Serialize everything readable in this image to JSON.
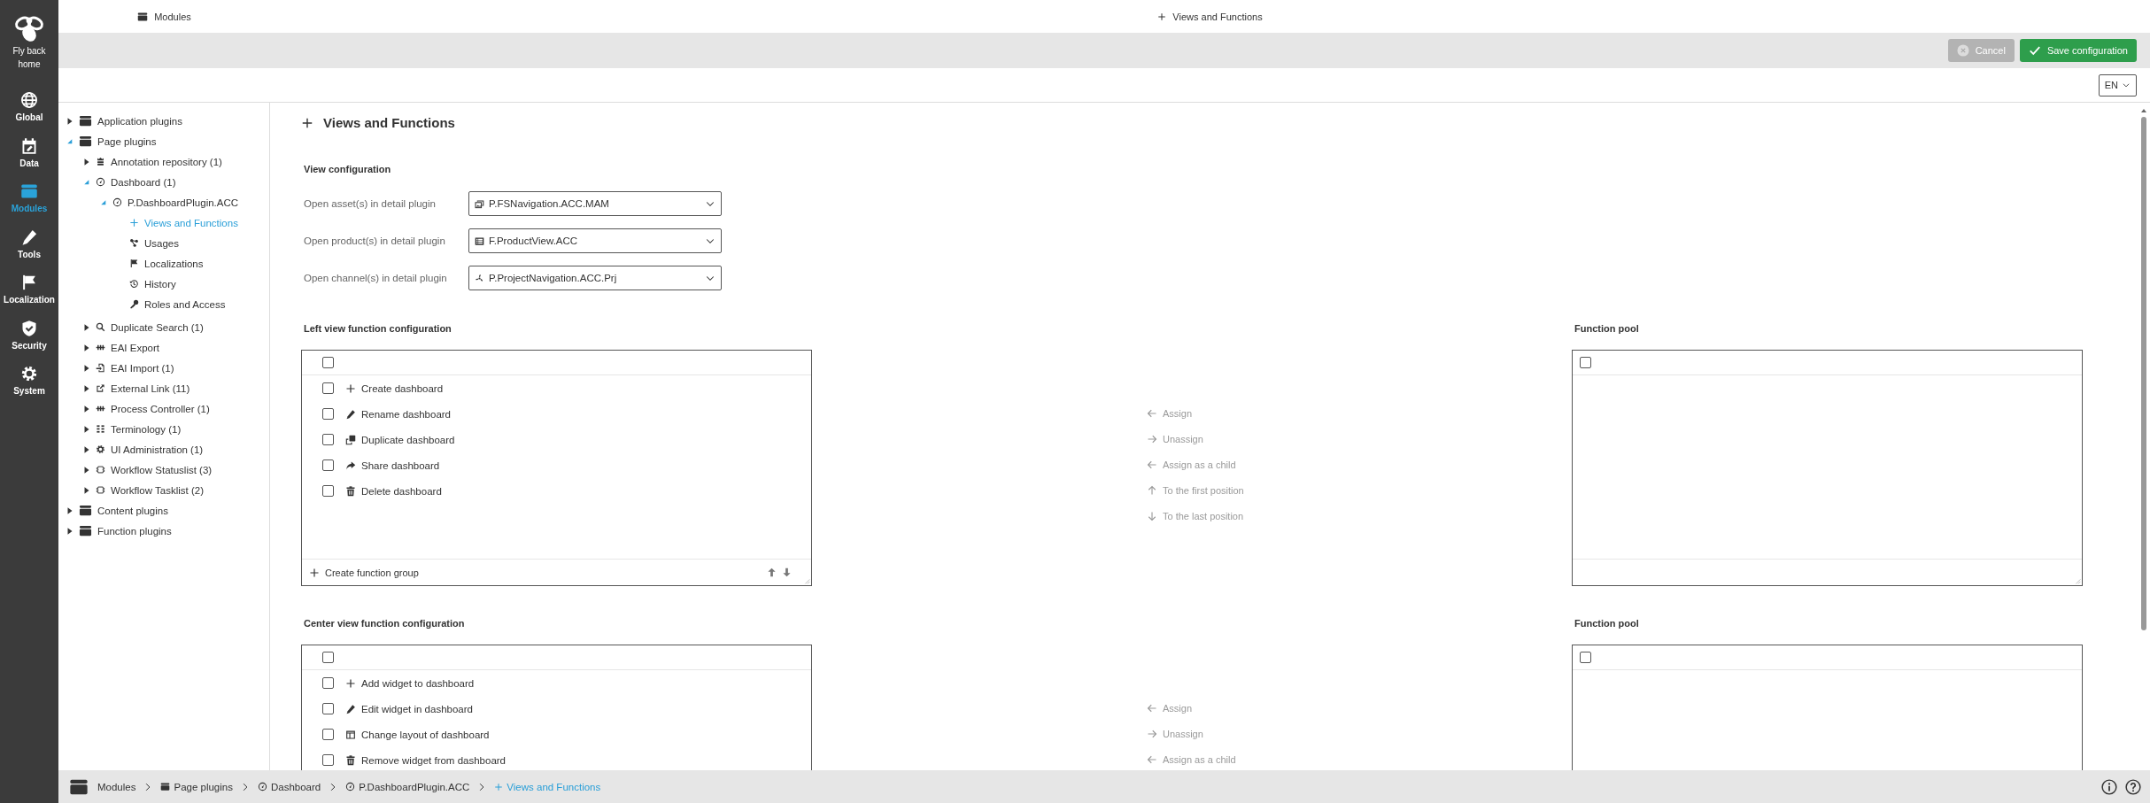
{
  "rail": {
    "logo_label": "Fly back home",
    "items": [
      {
        "label": "Global",
        "kind": "globe",
        "selected": false
      },
      {
        "label": "Data",
        "kind": "calendar",
        "selected": false
      },
      {
        "label": "Modules",
        "kind": "module",
        "selected": true
      },
      {
        "label": "Tools",
        "kind": "pencil",
        "selected": false
      },
      {
        "label": "Localization",
        "kind": "flag",
        "selected": false
      },
      {
        "label": "Security",
        "kind": "shield",
        "selected": false
      },
      {
        "label": "System",
        "kind": "gear",
        "selected": false
      }
    ]
  },
  "header": {
    "left_title": {
      "label": "Modules",
      "kind": "module"
    },
    "right_title": {
      "label": "Views and Functions",
      "kind": "plus"
    }
  },
  "toolbar": {
    "buttons": [
      {
        "label": "Cancel",
        "kind": "cancel",
        "disabled": true
      },
      {
        "label": "Save configuration",
        "kind": "save",
        "disabled": false
      }
    ],
    "language": "EN"
  },
  "tree": [
    {
      "label": "Application plugins",
      "kind": "module",
      "expanded": false,
      "selected": false
    },
    {
      "label": "Page plugins",
      "kind": "module",
      "expanded": true,
      "selected": false,
      "children": [
        {
          "label": "Annotation repository (1)",
          "kind": "annotation",
          "expanded": false,
          "selected": false
        },
        {
          "label": "Dashboard (1)",
          "kind": "gauge",
          "expanded": true,
          "selected": false,
          "children": [
            {
              "label": "P.DashboardPlugin.ACC",
              "kind": "gauge",
              "expanded": true,
              "selected": false,
              "children": [
                {
                  "label": "Views and Functions",
                  "kind": "plus",
                  "selected": true
                },
                {
                  "label": "Usages",
                  "kind": "nodes",
                  "selected": false
                },
                {
                  "label": "Localizations",
                  "kind": "flag",
                  "selected": false
                },
                {
                  "label": "History",
                  "kind": "history",
                  "selected": false
                },
                {
                  "label": "Roles and Access",
                  "kind": "key",
                  "selected": false
                }
              ]
            }
          ]
        },
        {
          "label": "Duplicate Search (1)",
          "kind": "search",
          "expanded": false,
          "selected": false
        },
        {
          "label": "EAI Export",
          "kind": "plug",
          "expanded": false,
          "selected": false
        },
        {
          "label": "EAI Import (1)",
          "kind": "import",
          "expanded": false,
          "selected": false
        },
        {
          "label": "External Link (11)",
          "kind": "external",
          "expanded": false,
          "selected": false
        },
        {
          "label": "Process Controller (1)",
          "kind": "plug",
          "expanded": false,
          "selected": false
        },
        {
          "label": "Terminology (1)",
          "kind": "columns",
          "expanded": false,
          "selected": false
        },
        {
          "label": "UI Administration (1)",
          "kind": "gear",
          "expanded": false,
          "selected": false
        },
        {
          "label": "Workflow Statuslist (3)",
          "kind": "workflow",
          "expanded": false,
          "selected": false
        },
        {
          "label": "Workflow Tasklist (2)",
          "kind": "workflow",
          "expanded": false,
          "selected": false
        }
      ]
    },
    {
      "label": "Content plugins",
      "kind": "module",
      "expanded": false,
      "selected": false
    },
    {
      "label": "Function plugins",
      "kind": "module",
      "expanded": false,
      "selected": false
    }
  ],
  "content": {
    "title": "Views and Functions",
    "kind": "plus",
    "view_configuration": {
      "title": "View configuration",
      "fields": [
        {
          "label": "Open asset(s) in detail plugin",
          "value": "P.FSNavigation.ACC.MAM",
          "kind": "images"
        },
        {
          "label": "Open product(s) in detail plugin",
          "value": "F.ProductView.ACC",
          "kind": "list"
        },
        {
          "label": "Open channel(s) in detail plugin",
          "value": "P.ProjectNavigation.ACC.Prj",
          "kind": "fan"
        }
      ]
    },
    "sections": [
      {
        "title": "Left view function configuration",
        "select_all_checked": false,
        "items": [
          {
            "label": "Create dashboard",
            "kind": "plus",
            "checked": false
          },
          {
            "label": "Rename dashboard",
            "kind": "pencil",
            "checked": false
          },
          {
            "label": "Duplicate dashboard",
            "kind": "copy",
            "checked": false
          },
          {
            "label": "Share dashboard",
            "kind": "share",
            "checked": false
          },
          {
            "label": "Delete dashboard",
            "kind": "trash",
            "checked": false
          }
        ],
        "footer": "Create function group",
        "actions": [
          {
            "label": "Assign",
            "kind": "left",
            "disabled": true
          },
          {
            "label": "Unassign",
            "kind": "right",
            "disabled": true
          },
          {
            "label": "Assign as a child",
            "kind": "left",
            "disabled": true
          },
          {
            "label": "To the first position",
            "kind": "up",
            "disabled": true
          },
          {
            "label": "To the last position",
            "kind": "down",
            "disabled": true
          }
        ],
        "pool": {
          "title": "Function pool",
          "select_all_checked": false
        }
      },
      {
        "title": "Center view function configuration",
        "select_all_checked": false,
        "items": [
          {
            "label": "Add widget to dashboard",
            "kind": "plus",
            "checked": false
          },
          {
            "label": "Edit widget in dashboard",
            "kind": "pencil",
            "checked": false
          },
          {
            "label": "Change layout of dashboard",
            "kind": "layout",
            "checked": false
          },
          {
            "label": "Remove widget from dashboard",
            "kind": "trash",
            "checked": false
          }
        ],
        "actions": [
          {
            "label": "Assign",
            "kind": "left",
            "disabled": true
          },
          {
            "label": "Unassign",
            "kind": "right",
            "disabled": true
          },
          {
            "label": "Assign as a child",
            "kind": "left",
            "disabled": true
          }
        ],
        "pool": {
          "title": "Function pool",
          "select_all_checked": false
        }
      }
    ]
  },
  "breadcrumb": [
    {
      "label": "Modules",
      "kind": "module",
      "selected": false
    },
    {
      "label": "Page plugins",
      "kind": "module",
      "selected": false
    },
    {
      "label": "Dashboard",
      "kind": "gauge",
      "selected": false
    },
    {
      "label": "P.DashboardPlugin.ACC",
      "kind": "gauge",
      "selected": false
    },
    {
      "label": "Views and Functions",
      "kind": "plus",
      "selected": true
    }
  ]
}
